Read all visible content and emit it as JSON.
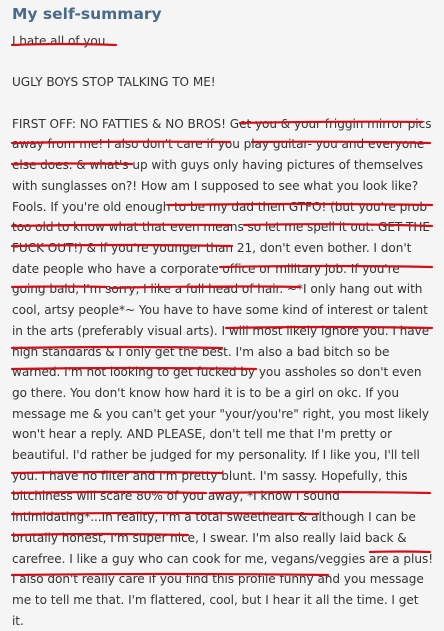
{
  "section": {
    "title": "My self-summary"
  },
  "paragraphs": [
    "I hate all of you.",
    "UGLY BOYS STOP TALKING TO ME!",
    "FIRST OFF: NO FATTIES & NO BROS! Get you & your friggin mirror pics away from me! I also don't care if you play guitar- you and everyone else does. & what's up with guys only having pictures of themselves with sunglasses on?! How am I supposed to see what you look like? Fools. If you're old enough to be my dad then GTFO! (but you're prob too old to know what that even means so let me spell it out: GET THE FUCK OUT!) & if you're younger than 21, don't even bother. I don't date people who have a corporate office or military job. If you're going bald, I'm sorry, I like a full head of hair. ~*I only hang out with cool, artsy people*~ You have to have some kind of interest or talent in the arts (preferably visual arts). I will most likely ignore you. I have high standards & I only get the best. I'm also a bad bitch so be warned. I'm not looking to get fucked by you assholes so don't even go there. You don't know how hard it is to be a girl on okc. If you message me & you can't get your \"your/you're\" right, you most likely won't hear a reply. AND PLEASE, don't tell me that I'm pretty or beautiful. I'd rather be judged for my personality. If I like you, I'll tell you. I have no filter and I'm pretty blunt. I'm sassy. Hopefully, this bitchiness will scare 80% of you away, *I know I sound intimidating*...In reality, I'm a total sweetheart & although I can be brutally honest, I'm super nice, I swear. I'm also really laid back & carefree. I like a guy who can cook for me, vegans/veggies are a plus! I also don't really care if you find this profile funny and you message me to tell me that. I'm flattered, cool, but I hear it all the time. I get it."
  ],
  "colors": {
    "heading": "#4a6a8c",
    "text": "#333333",
    "underline": "#d0101a",
    "background": "#f5f5f5"
  }
}
